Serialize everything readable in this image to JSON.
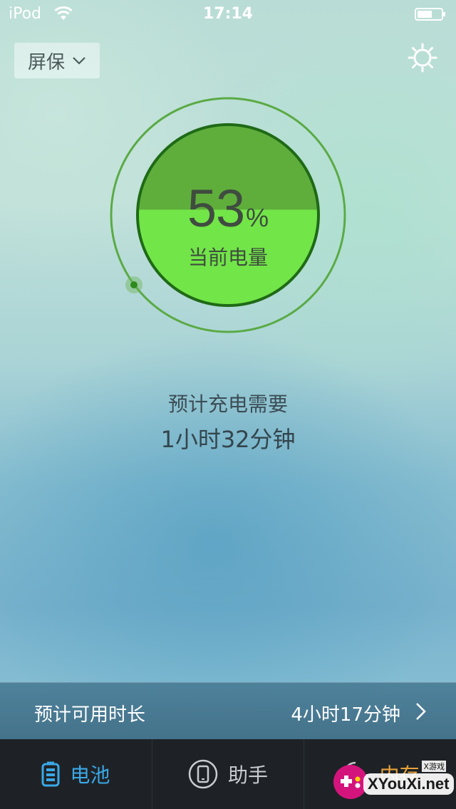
{
  "status_bar": {
    "carrier": "iPod",
    "time": "17:14"
  },
  "header": {
    "screensaver_label": "屏保"
  },
  "gauge": {
    "percent": "53",
    "percent_sign": "%",
    "caption": "当前电量",
    "level": 0.53
  },
  "charge": {
    "label": "预计充电需要",
    "time": "1小时32分钟"
  },
  "usable": {
    "label": "预计可用时长",
    "value": "4小时17分钟"
  },
  "tabs": [
    {
      "label": "电池",
      "icon": "battery-icon",
      "active": true
    },
    {
      "label": "助手",
      "icon": "phone-icon",
      "active": false
    },
    {
      "label": "内存",
      "icon": "memory-icon",
      "active": false
    }
  ],
  "watermark": {
    "text": "XYouXi.net",
    "small": "X游戏"
  },
  "colors": {
    "accent": "#3aa8e6",
    "gauge_fill_dark": "#5fae3c",
    "gauge_fill_light": "#72e548",
    "gauge_ring": "#5aaa45",
    "tab_bar": "#1e2226"
  }
}
